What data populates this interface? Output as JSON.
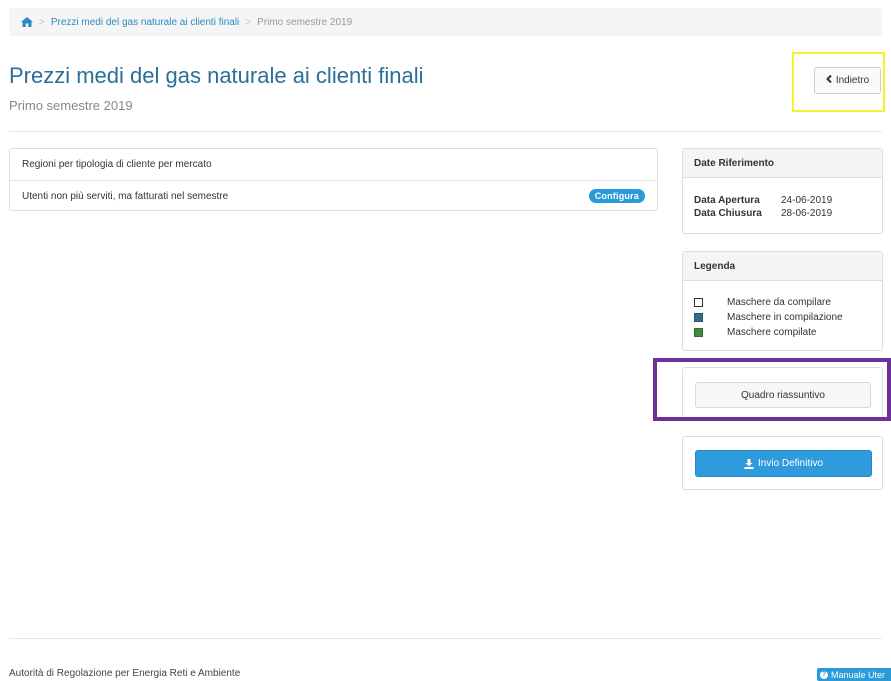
{
  "breadcrumb": {
    "home_icon": "home-icon",
    "separator": ">",
    "link": "Prezzi medi del gas naturale ai clienti finali",
    "current": "Primo semestre 2019"
  },
  "header": {
    "title": "Prezzi medi del gas naturale ai clienti finali",
    "subtitle": "Primo semestre 2019",
    "back_label": "Indietro",
    "back_icon": "chevron-left-icon"
  },
  "list": [
    {
      "label": "Regioni per tipologia di cliente per mercato",
      "badge": ""
    },
    {
      "label": "Utenti non più serviti, ma fatturati nel semestre",
      "badge": "Configura"
    }
  ],
  "dates_panel": {
    "heading": "Date Riferimento",
    "rows": [
      {
        "label": "Data Apertura",
        "value": "24-06-2019"
      },
      {
        "label": "Data Chiusura",
        "value": "28-06-2019"
      }
    ]
  },
  "legend_panel": {
    "heading": "Legenda",
    "items": [
      {
        "label": "Maschere da compilare",
        "color": "#ffffff"
      },
      {
        "label": "Maschere in compilazione",
        "color": "#2f6f8d"
      },
      {
        "label": "Maschere compilate",
        "color": "#3e8a3e"
      }
    ]
  },
  "summary_button": "Quadro riassuntivo",
  "submit_button": {
    "label": "Invio Definitivo",
    "icon": "download-icon"
  },
  "footer": {
    "text": "Autorità di Regolazione per Energia Reti e Ambiente",
    "manual_label": "Manuale Uter",
    "manual_icon": "help-circle-icon"
  },
  "colors": {
    "accent": "#2a9bd8",
    "title": "#2a6f97",
    "highlight_yellow": "#f4f22f",
    "highlight_purple": "#6e2f98"
  }
}
